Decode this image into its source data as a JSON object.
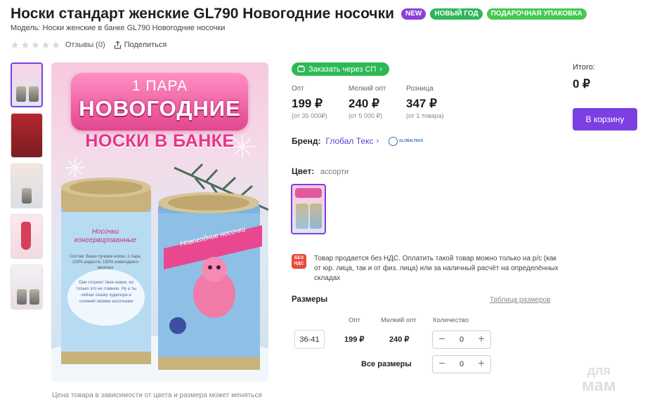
{
  "product": {
    "title": "Носки стандарт женские GL790 Новогодние носочки",
    "badges": {
      "new": "NEW",
      "new_year": "НОВЫЙ ГОД",
      "gift": "ПОДАРОЧНАЯ УПАКОВКА"
    },
    "model": "Модель: Носки женские в банке GL790 Новогодние носочки",
    "rating_stars": 0,
    "reviews": "Отзывы  (0)",
    "share": "Поделиться"
  },
  "gallery": {
    "thumbnails": [
      "image-1",
      "image-2",
      "image-3",
      "image-4",
      "image-5"
    ],
    "active_index": 0,
    "image_text": {
      "line1": "1 ПАРА",
      "line2": "НОВОГОДНИЕ",
      "line3": "НОСКИ В БАНКЕ"
    },
    "can_left": {
      "label1": "Носочки",
      "label2": "консервированные",
      "composition": "Состав: Ваши лучшие носки, 1 пара, 100% радости, 150% новогоднего веселья",
      "wish": "Они согреют твои ножки, но только это не главное. Ну а ты сейчас сказку чудесную и сочиняй своими носочками"
    },
    "can_right": {
      "ribbon": "Новогодние носочки"
    },
    "caption": "Цена товара в зависимости от цвета и размера может меняться"
  },
  "order_button": "Заказать через СП",
  "prices": [
    {
      "label": "Опт",
      "value": "199 ₽",
      "note": "(от 35 000₽)"
    },
    {
      "label": "Мелкий опт",
      "value": "240 ₽",
      "note": "(от 5 000 ₽)"
    },
    {
      "label": "Розница",
      "value": "347 ₽",
      "note": "(от 1 товара)"
    }
  ],
  "total": {
    "label": "Итого:",
    "value": "0 ₽"
  },
  "cart_button": "В корзину",
  "brand": {
    "label": "Бренд:",
    "name": "Глобал Текс",
    "logo_text": "GLOBALTEKS"
  },
  "color": {
    "label": "Цвет:",
    "value": "ассорти"
  },
  "vat": {
    "icon": "БЕЗ НДС",
    "text": "Товар продается без НДС. Оплатить такой товар можно только на р/с (как от юр. лица, так и от физ. лица) или за наличный расчёт на определённых складах"
  },
  "sizes": {
    "title": "Размеры",
    "table_link": "Таблица размеров",
    "headers": {
      "opt": "Опт",
      "small_opt": "Мелкий опт",
      "qty": "Количество"
    },
    "rows": [
      {
        "size": "36-41",
        "opt": "199 ₽",
        "small_opt": "240 ₽",
        "qty": "0"
      }
    ],
    "all_label": "Все размеры",
    "all_qty": "0",
    "minus": "−",
    "plus": "+"
  },
  "watermark": {
    "line1": "для",
    "line2": "мам"
  }
}
